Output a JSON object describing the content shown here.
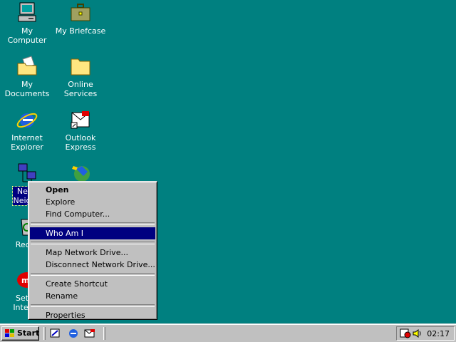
{
  "desktop": {
    "icons": [
      {
        "label": "My Computer"
      },
      {
        "label": "My Briefcase"
      },
      {
        "label": "My Documents"
      },
      {
        "label": "Online\nServices"
      },
      {
        "label": "Internet\nExplorer"
      },
      {
        "label": "Outlook\nExpress"
      },
      {
        "label": "Netw\nNeighb"
      },
      {
        "label": "Recyc"
      },
      {
        "label": "Setup\nInterne"
      }
    ]
  },
  "context_menu": {
    "items": [
      {
        "label": "Open"
      },
      {
        "label": "Explore"
      },
      {
        "label": "Find Computer..."
      },
      {
        "label": "Who Am I"
      },
      {
        "label": "Map Network Drive..."
      },
      {
        "label": "Disconnect Network Drive..."
      },
      {
        "label": "Create Shortcut"
      },
      {
        "label": "Rename"
      },
      {
        "label": "Properties"
      }
    ]
  },
  "taskbar": {
    "start_label": "Start",
    "clock": "02:17"
  },
  "colors": {
    "desktop": "#008080",
    "highlight": "#000080",
    "face": "#c0c0c0"
  }
}
